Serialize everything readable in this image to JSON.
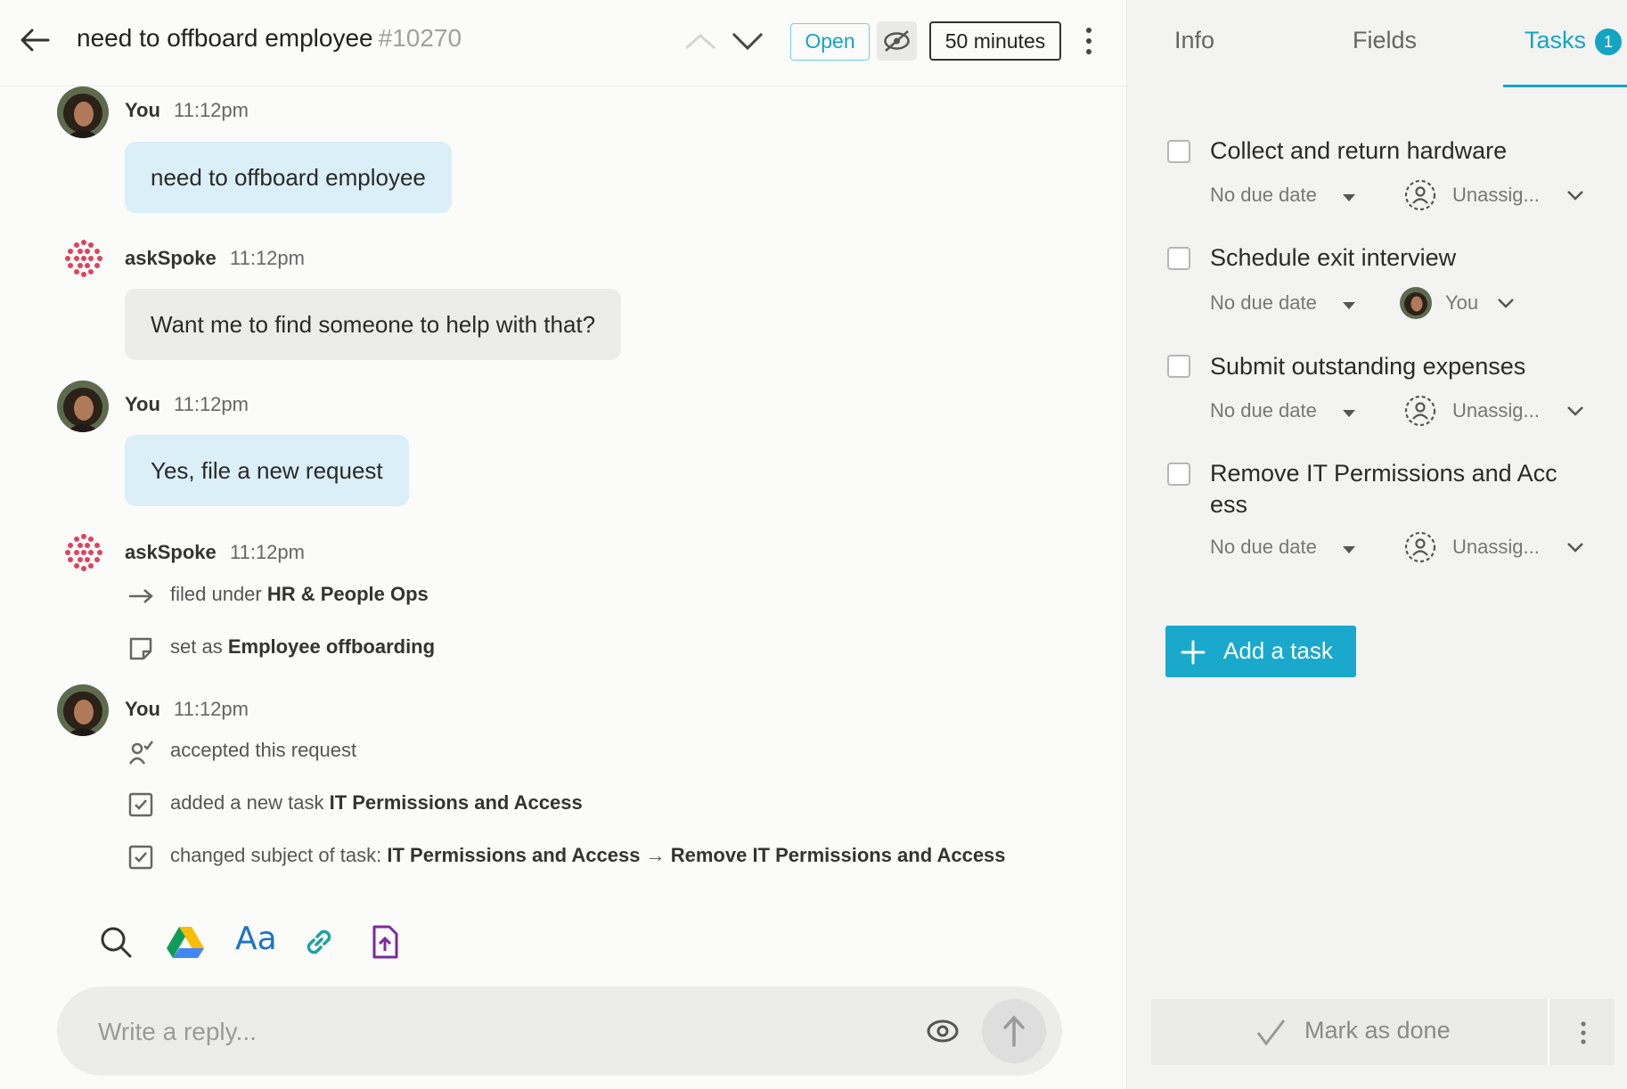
{
  "header": {
    "subject": "need to offboard employee",
    "ticket_id": "#10270",
    "status": "Open",
    "timer": "50 minutes"
  },
  "conversation": [
    {
      "type": "message",
      "author": "You",
      "time": "11:12pm",
      "text": "need to offboard employee"
    },
    {
      "type": "message",
      "author": "askSpoke",
      "time": "11:12pm",
      "text": "Want me to find someone to help with that?"
    },
    {
      "type": "message",
      "author": "You",
      "time": "11:12pm",
      "text": "Yes, file a new request"
    },
    {
      "type": "events",
      "author": "askSpoke",
      "time": "11:12pm",
      "events": [
        {
          "prefix": "filed under",
          "bold": "HR & People Ops"
        },
        {
          "prefix": "set as",
          "bold": "Employee offboarding"
        }
      ]
    },
    {
      "type": "events",
      "author": "You",
      "time": "11:12pm",
      "events": [
        {
          "prefix": "accepted this request",
          "bold": ""
        },
        {
          "prefix": "added a new task",
          "bold": "IT Permissions and Access"
        },
        {
          "prefix": "changed subject of task:",
          "bold": "IT Permissions and Access",
          "arrow": "→",
          "bold2": "Remove IT Permissions and Access"
        }
      ]
    }
  ],
  "composer": {
    "placeholder": "Write a reply...",
    "tools": [
      "search-icon",
      "google-drive-icon",
      "text-format-icon",
      "link-icon",
      "file-upload-icon"
    ]
  },
  "sidebar": {
    "tabs": [
      {
        "label": "Info"
      },
      {
        "label": "Fields"
      },
      {
        "label": "Tasks",
        "badge": "1"
      }
    ],
    "tasks": [
      {
        "title": "Collect and return hardware",
        "due": "No due date",
        "assignee": "Unassig..."
      },
      {
        "title": "Schedule exit interview",
        "due": "No due date",
        "assignee": "You"
      },
      {
        "title": "Submit outstanding expenses",
        "due": "No due date",
        "assignee": "Unassig..."
      },
      {
        "title": "Remove IT Permissions and Acc ess",
        "due": "No due date",
        "assignee": "Unassig..."
      }
    ],
    "add_task_label": "Add a task",
    "mark_done_label": "Mark as done"
  },
  "colors": {
    "accent": "#14a4c4",
    "button": "#1aa8cc",
    "my_bubble": "#dbeff8",
    "bot_bubble": "#ececeb"
  }
}
